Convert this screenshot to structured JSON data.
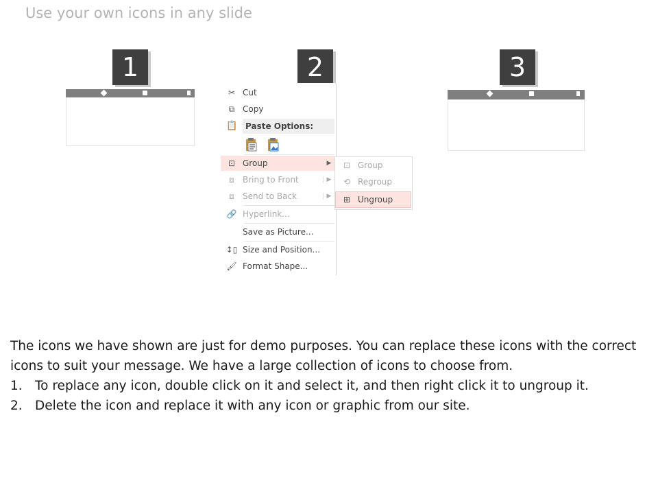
{
  "slide": {
    "title": "Use your own icons in any slide"
  },
  "steps": [
    {
      "number": "1"
    },
    {
      "number": "2"
    },
    {
      "number": "3"
    }
  ],
  "context_menu": {
    "cut": "Cut",
    "copy": "Copy",
    "paste_options": "Paste Options:",
    "group": "Group",
    "bring_to_front": "Bring to Front",
    "send_to_back": "Send to Back",
    "hyperlink": "Hyperlink...",
    "save_as_picture": "Save as Picture...",
    "size_and_position": "Size and Position...",
    "format_shape": "Format Shape..."
  },
  "group_submenu": {
    "group": "Group",
    "regroup": "Regroup",
    "ungroup": "Ungroup"
  },
  "body": {
    "intro": "The icons we have shown are just for demo purposes. You can replace these icons with the correct icons to suit your message. We have a large collection of icons to choose from.",
    "items": [
      {
        "num": "1.",
        "text": "To replace any icon, double click on it and select it, and then right click it to ungroup it."
      },
      {
        "num": "2.",
        "text": "Delete the icon and replace it with any icon or graphic from our site."
      }
    ]
  },
  "colors": {
    "step_box": "#3f3f3f",
    "orange": "#f58232",
    "red": "#e15759",
    "blue": "#3aa6e0",
    "highlight": "#fde4e1"
  }
}
